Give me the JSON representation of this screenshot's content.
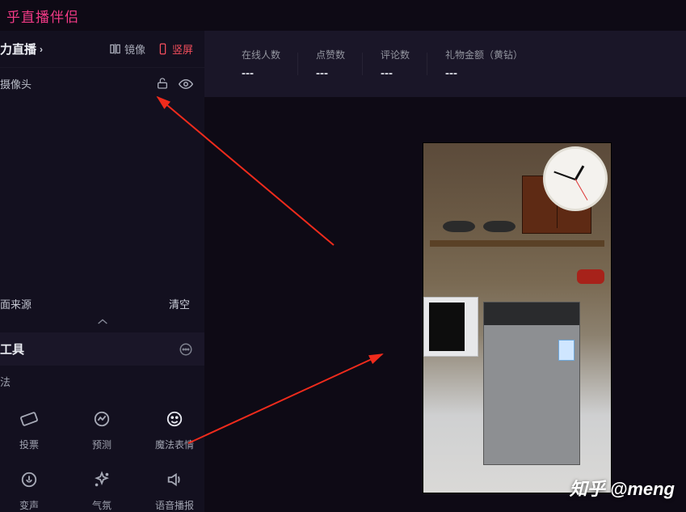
{
  "titlebar": {
    "app_title": "乎直播伴侣"
  },
  "sidebar": {
    "live_section": {
      "title": "力直播",
      "mirror_label": "镜像",
      "vertical_label": "竖屏"
    },
    "camera_row": {
      "label": "摄像头"
    },
    "source_row": {
      "label": "面来源",
      "clear_label": "清空"
    },
    "tools_section": {
      "title": "工具",
      "play_label": "法",
      "items": [
        {
          "key": "vote",
          "label": "投票"
        },
        {
          "key": "predict",
          "label": "预测"
        },
        {
          "key": "magic",
          "label": "魔法表情"
        },
        {
          "key": "voice",
          "label": "变声"
        },
        {
          "key": "mood",
          "label": "气氛"
        },
        {
          "key": "tts",
          "label": "语音播报"
        }
      ]
    }
  },
  "stats": {
    "online": {
      "label": "在线人数",
      "value": "---"
    },
    "likes": {
      "label": "点赞数",
      "value": "---"
    },
    "comments": {
      "label": "评论数",
      "value": "---"
    },
    "gifts": {
      "label": "礼物金额（黄钻）",
      "value": "---"
    }
  },
  "watermark": "知乎 @meng"
}
